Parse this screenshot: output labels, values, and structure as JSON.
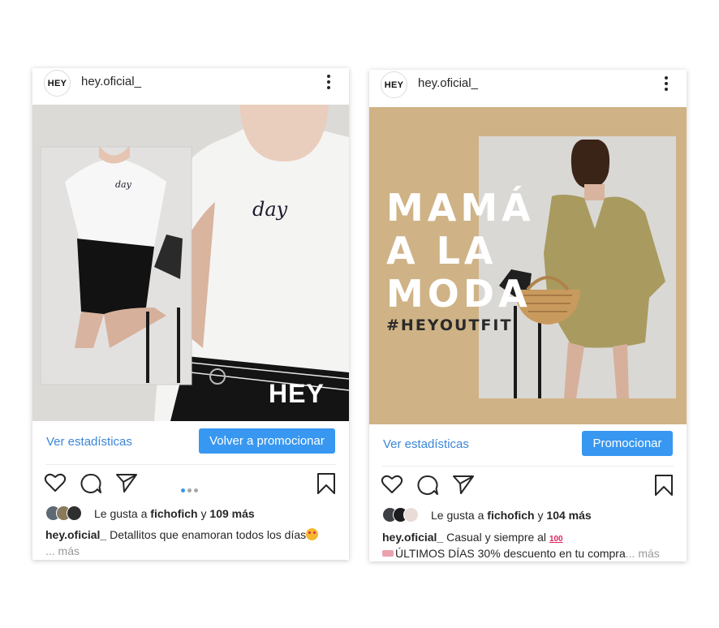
{
  "posts": [
    {
      "avatar_text": "HEY",
      "username": "hey.oficial_",
      "image": {
        "tee_text": "day",
        "inset_tee_text": "day",
        "logo": "HEY"
      },
      "stats_link": "Ver estadísticas",
      "promote_button": "Volver a promocionar",
      "liked_prefix": "Le gusta a",
      "liked_by": "fichofich",
      "liked_connector": "y",
      "liked_count": "109 más",
      "caption_user": "hey.oficial_",
      "caption_text": "Detallitos que enamoran todos los días",
      "caption_more": "... más",
      "carousel_dots": 3,
      "carousel_active": 0
    },
    {
      "avatar_text": "HEY",
      "username": "hey.oficial_",
      "image": {
        "headline": [
          "MAMÁ",
          "A LA",
          "MODA"
        ],
        "hashtag": "#HEYOUTFIT"
      },
      "stats_link": "Ver estadísticas",
      "promote_button": "Promocionar",
      "liked_prefix": "Le gusta a",
      "liked_by": "fichofich",
      "liked_connector": "y",
      "liked_count": "104 más",
      "caption_user": "hey.oficial_",
      "caption_text": "Casual y siempre al",
      "caption_line2": "ÚLTIMOS DÍAS 30% descuento en tu compra",
      "caption_more": "... más"
    }
  ],
  "icons": [
    "heart-icon",
    "comment-icon",
    "share-icon",
    "bookmark-icon",
    "more-options-icon"
  ],
  "colors": {
    "accent": "#3897f0",
    "link": "#3b86d8",
    "post2_background": "#cfb386"
  }
}
